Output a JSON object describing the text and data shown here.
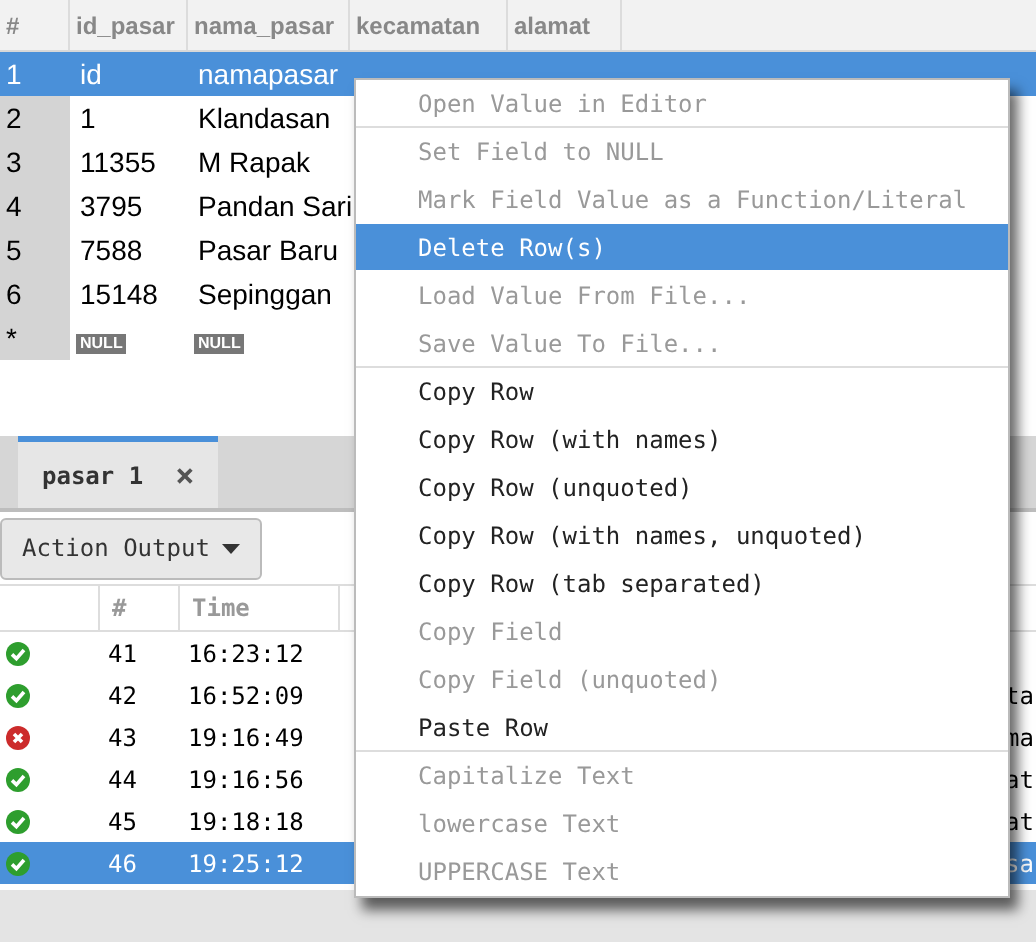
{
  "grid": {
    "columns": [
      "#",
      "id_pasar",
      "nama_pasar",
      "kecamatan",
      "alamat"
    ],
    "rows": [
      {
        "cells": [
          "1",
          "id",
          "namapasar"
        ],
        "selected": true
      },
      {
        "cells": [
          "2",
          "1",
          "Klandasan"
        ],
        "selected": false
      },
      {
        "cells": [
          "3",
          "11355",
          "M Rapak"
        ],
        "selected": false
      },
      {
        "cells": [
          "4",
          "3795",
          "Pandan Sari"
        ],
        "selected": false
      },
      {
        "cells": [
          "5",
          "7588",
          "Pasar Baru"
        ],
        "selected": false
      },
      {
        "cells": [
          "6",
          "15148",
          "Sepinggan"
        ],
        "selected": false
      },
      {
        "cells": [
          "*",
          "NULL",
          "NULL"
        ],
        "selected": false
      }
    ]
  },
  "tabs": [
    {
      "label": "pasar 1",
      "close": "×",
      "selected": true
    }
  ],
  "output": {
    "button": "Action Output",
    "columns": [
      "#",
      "Time"
    ],
    "rows": [
      {
        "kind": "ok",
        "num": "41",
        "time": "16:23:12",
        "selected": false
      },
      {
        "kind": "ok",
        "num": "42",
        "time": "16:52:09",
        "column_4": "ta",
        "selected": false
      },
      {
        "kind": "error",
        "num": "43",
        "time": "19:16:49",
        "column_4": "ma",
        "selected": false
      },
      {
        "kind": "ok",
        "num": "44",
        "time": "19:16:56",
        "column_4": "at",
        "selected": false
      },
      {
        "kind": "ok",
        "num": "45",
        "time": "19:18:18",
        "column_4": "at",
        "selected": false
      },
      {
        "kind": "ok",
        "num": "46",
        "time": "19:25:12",
        "column_4": "sa",
        "selected": true
      }
    ]
  },
  "context_menu": [
    {
      "label": "Open Value in Editor",
      "disabled": true,
      "selected": false,
      "separator_after": true
    },
    {
      "label": "Set Field to NULL",
      "disabled": true,
      "selected": false,
      "separator_after": false
    },
    {
      "label": "Mark Field Value as a Function/Literal",
      "disabled": true,
      "selected": false,
      "separator_after": false
    },
    {
      "label": "Delete Row(s)",
      "disabled": false,
      "selected": true,
      "separator_after": false
    },
    {
      "label": "Load Value From File...",
      "disabled": true,
      "selected": false,
      "separator_after": false
    },
    {
      "label": "Save Value To File...",
      "disabled": true,
      "selected": false,
      "separator_after": true
    },
    {
      "label": "Copy Row",
      "disabled": false,
      "selected": false,
      "separator_after": false
    },
    {
      "label": "Copy Row (with names)",
      "disabled": false,
      "selected": false,
      "separator_after": false
    },
    {
      "label": "Copy Row (unquoted)",
      "disabled": false,
      "selected": false,
      "separator_after": false
    },
    {
      "label": "Copy Row (with names, unquoted)",
      "disabled": false,
      "selected": false,
      "separator_after": false
    },
    {
      "label": "Copy Row (tab separated)",
      "disabled": false,
      "selected": false,
      "separator_after": false
    },
    {
      "label": "Copy Field",
      "disabled": true,
      "selected": false,
      "separator_after": false
    },
    {
      "label": "Copy Field (unquoted)",
      "disabled": true,
      "selected": false,
      "separator_after": false
    },
    {
      "label": "Paste Row",
      "disabled": false,
      "selected": false,
      "separator_after": true
    },
    {
      "label": "Capitalize Text",
      "disabled": true,
      "selected": false,
      "separator_after": false
    },
    {
      "label": "lowercase Text",
      "disabled": true,
      "selected": false,
      "separator_after": false
    },
    {
      "label": "UPPERCASE Text",
      "disabled": true,
      "selected": false,
      "separator_after": false
    }
  ]
}
